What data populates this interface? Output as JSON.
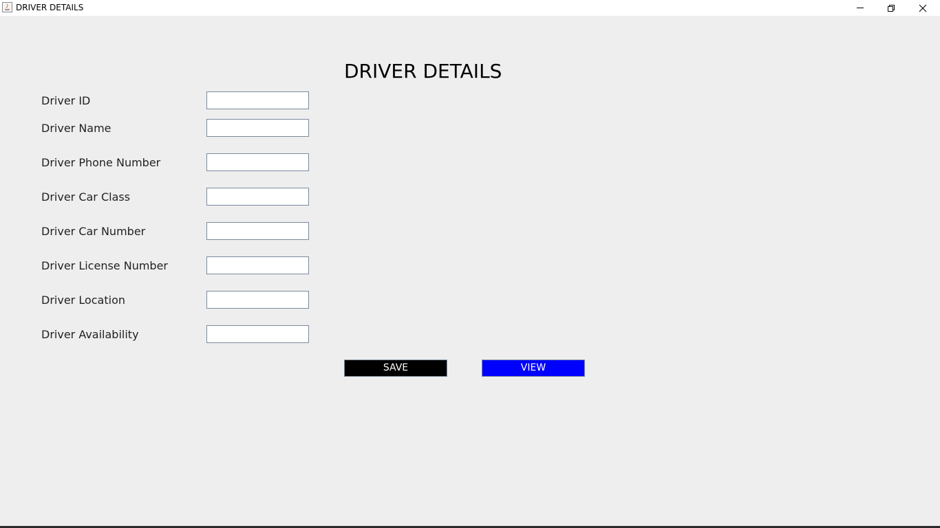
{
  "window": {
    "title": "DRIVER DETAILS",
    "controls": {
      "minimize_icon": "minimize-icon",
      "maximize_icon": "restore-icon",
      "close_icon": "close-icon"
    }
  },
  "form": {
    "heading": "DRIVER DETAILS",
    "fields": [
      {
        "label": "Driver ID",
        "value": "",
        "placeholder": ""
      },
      {
        "label": "Driver Name",
        "value": "",
        "placeholder": ""
      },
      {
        "label": "Driver Phone Number",
        "value": "",
        "placeholder": ""
      },
      {
        "label": "Driver Car Class",
        "value": "",
        "placeholder": ""
      },
      {
        "label": "Driver Car Number",
        "value": "",
        "placeholder": ""
      },
      {
        "label": "Driver License Number",
        "value": "",
        "placeholder": ""
      },
      {
        "label": "Driver Location",
        "value": "",
        "placeholder": ""
      },
      {
        "label": "Driver Availability",
        "value": "",
        "placeholder": ""
      }
    ],
    "buttons": {
      "save_label": "SAVE",
      "view_label": "VIEW",
      "save_color": "#000000",
      "view_color": "#0000ff"
    }
  }
}
